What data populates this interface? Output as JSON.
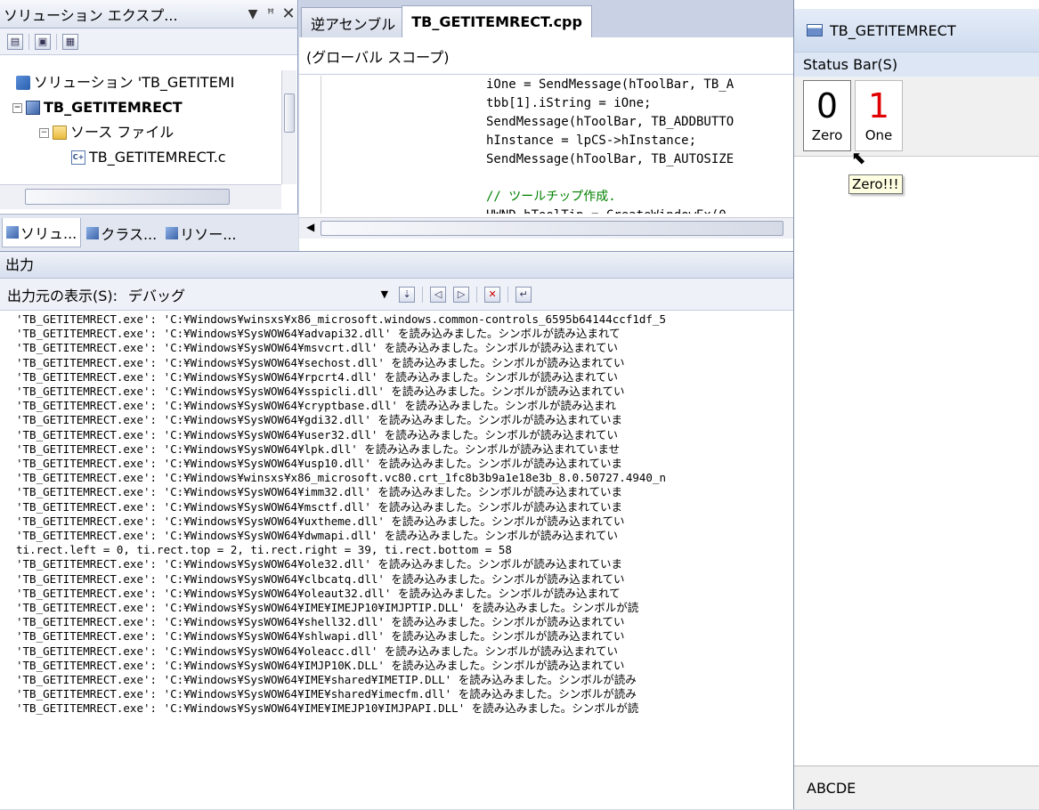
{
  "solution_explorer": {
    "title": "ソリューション エクスプ...",
    "pin": "ꟸ",
    "tree": [
      {
        "label": "ソリューション 'TB_GETITEMI",
        "level": 0
      },
      {
        "label": "TB_GETITEMRECT",
        "level": 1
      },
      {
        "label": "ソース ファイル",
        "level": 2
      },
      {
        "label": "TB_GETITEMRECT.c",
        "level": 3
      }
    ],
    "tabs": [
      "ソリュ...",
      "クラス...",
      "リソー..."
    ]
  },
  "editor": {
    "tabs": [
      "逆アセンブル",
      "TB_GETITEMRECT.cpp"
    ],
    "scope": "(グローバル スコープ)",
    "code": [
      "iOne = SendMessage(hToolBar, TB_A",
      "tbb[1].iString = iOne;",
      "SendMessage(hToolBar, TB_ADDBUTTO",
      "hInstance = lpCS->hInstance;",
      "SendMessage(hToolBar, TB_AUTOSIZE",
      "",
      "// ツールチップ作成."
    ],
    "code_cutoff": "HWND hToolTip = CreateWindowEx(0"
  },
  "output": {
    "title": "出力",
    "source_label": "出力元の表示(S):",
    "source_value": "デバッグ",
    "lines": [
      "'TB_GETITEMRECT.exe': 'C:¥Windows¥winsxs¥x86_microsoft.windows.common-controls_6595b64144ccf1df_5",
      "'TB_GETITEMRECT.exe': 'C:¥Windows¥SysWOW64¥advapi32.dll' を読み込みました。シンボルが読み込まれて",
      "'TB_GETITEMRECT.exe': 'C:¥Windows¥SysWOW64¥msvcrt.dll' を読み込みました。シンボルが読み込まれてい",
      "'TB_GETITEMRECT.exe': 'C:¥Windows¥SysWOW64¥sechost.dll' を読み込みました。シンボルが読み込まれてい",
      "'TB_GETITEMRECT.exe': 'C:¥Windows¥SysWOW64¥rpcrt4.dll' を読み込みました。シンボルが読み込まれてい",
      "'TB_GETITEMRECT.exe': 'C:¥Windows¥SysWOW64¥sspicli.dll' を読み込みました。シンボルが読み込まれてい",
      "'TB_GETITEMRECT.exe': 'C:¥Windows¥SysWOW64¥cryptbase.dll' を読み込みました。シンボルが読み込まれ",
      "'TB_GETITEMRECT.exe': 'C:¥Windows¥SysWOW64¥gdi32.dll' を読み込みました。シンボルが読み込まれていま",
      "'TB_GETITEMRECT.exe': 'C:¥Windows¥SysWOW64¥user32.dll' を読み込みました。シンボルが読み込まれてい",
      "'TB_GETITEMRECT.exe': 'C:¥Windows¥SysWOW64¥lpk.dll' を読み込みました。シンボルが読み込まれていませ",
      "'TB_GETITEMRECT.exe': 'C:¥Windows¥SysWOW64¥usp10.dll' を読み込みました。シンボルが読み込まれていま",
      "'TB_GETITEMRECT.exe': 'C:¥Windows¥winsxs¥x86_microsoft.vc80.crt_1fc8b3b9a1e18e3b_8.0.50727.4940_n",
      "'TB_GETITEMRECT.exe': 'C:¥Windows¥SysWOW64¥imm32.dll' を読み込みました。シンボルが読み込まれていま",
      "'TB_GETITEMRECT.exe': 'C:¥Windows¥SysWOW64¥msctf.dll' を読み込みました。シンボルが読み込まれていま",
      "'TB_GETITEMRECT.exe': 'C:¥Windows¥SysWOW64¥uxtheme.dll' を読み込みました。シンボルが読み込まれてい",
      "'TB_GETITEMRECT.exe': 'C:¥Windows¥SysWOW64¥dwmapi.dll' を読み込みました。シンボルが読み込まれてい",
      "ti.rect.left = 0, ti.rect.top = 2, ti.rect.right = 39, ti.rect.bottom = 58",
      "'TB_GETITEMRECT.exe': 'C:¥Windows¥SysWOW64¥ole32.dll' を読み込みました。シンボルが読み込まれていま",
      "'TB_GETITEMRECT.exe': 'C:¥Windows¥SysWOW64¥clbcatq.dll' を読み込みました。シンボルが読み込まれてい",
      "'TB_GETITEMRECT.exe': 'C:¥Windows¥SysWOW64¥oleaut32.dll' を読み込みました。シンボルが読み込まれて",
      "'TB_GETITEMRECT.exe': 'C:¥Windows¥SysWOW64¥IME¥IMEJP10¥IMJPTIP.DLL' を読み込みました。シンボルが読",
      "'TB_GETITEMRECT.exe': 'C:¥Windows¥SysWOW64¥shell32.dll' を読み込みました。シンボルが読み込まれてい",
      "'TB_GETITEMRECT.exe': 'C:¥Windows¥SysWOW64¥shlwapi.dll' を読み込みました。シンボルが読み込まれてい",
      "'TB_GETITEMRECT.exe': 'C:¥Windows¥SysWOW64¥oleacc.dll' を読み込みました。シンボルが読み込まれてい",
      "'TB_GETITEMRECT.exe': 'C:¥Windows¥SysWOW64¥IMJP10K.DLL' を読み込みました。シンボルが読み込まれてい",
      "'TB_GETITEMRECT.exe': 'C:¥Windows¥SysWOW64¥IME¥shared¥IMETIP.DLL' を読み込みました。シンボルが読み",
      "'TB_GETITEMRECT.exe': 'C:¥Windows¥SysWOW64¥IME¥shared¥imecfm.dll' を読み込みました。シンボルが読み",
      "'TB_GETITEMRECT.exe': 'C:¥Windows¥SysWOW64¥IME¥IMEJP10¥IMJPAPI.DLL' を読み込みました。シンボルが読"
    ]
  },
  "app": {
    "title": "TB_GETITEMRECT",
    "menu": "Status Bar(S)",
    "buttons": [
      {
        "glyph": "0",
        "label": "Zero",
        "color": "#000000"
      },
      {
        "glyph": "1",
        "label": "One",
        "color": "#e00000"
      }
    ],
    "tooltip": "Zero!!!",
    "status": "ABCDE"
  }
}
